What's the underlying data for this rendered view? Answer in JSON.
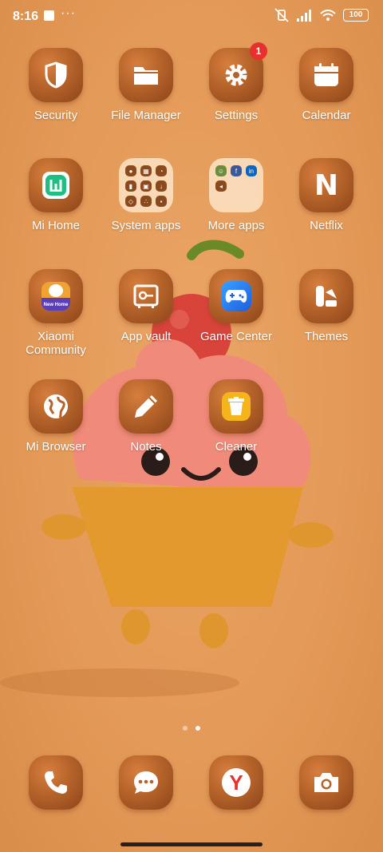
{
  "status_bar": {
    "time": "8:16",
    "battery": "100"
  },
  "apps": [
    {
      "label": "Security",
      "icon": "shield-icon"
    },
    {
      "label": "File Manager",
      "icon": "folder-icon"
    },
    {
      "label": "Settings",
      "icon": "gear-icon",
      "badge": "1"
    },
    {
      "label": "Calendar",
      "icon": "calendar-icon"
    },
    {
      "label": "Mi Home",
      "icon": "mi-home-icon"
    },
    {
      "label": "System apps",
      "icon": "folder-grid"
    },
    {
      "label": "More apps",
      "icon": "folder-grid"
    },
    {
      "label": "Netflix",
      "icon": "netflix-icon",
      "icon_text": "N"
    },
    {
      "label": "Xiaomi\nCommunity",
      "icon": "xiaomi-community-icon",
      "icon_text": "New Home"
    },
    {
      "label": "App vault",
      "icon": "vault-icon"
    },
    {
      "label": "Game Center",
      "icon": "gamepad-icon"
    },
    {
      "label": "Themes",
      "icon": "themes-icon"
    },
    {
      "label": "Mi Browser",
      "icon": "globe-icon"
    },
    {
      "label": "Notes",
      "icon": "pencil-icon"
    },
    {
      "label": "Cleaner",
      "icon": "trash-icon"
    }
  ],
  "dock": [
    {
      "name": "Phone",
      "icon": "phone-icon"
    },
    {
      "name": "Messaging",
      "icon": "message-icon"
    },
    {
      "name": "Yandex",
      "icon": "yandex-icon",
      "icon_text": "Y"
    },
    {
      "name": "Camera",
      "icon": "camera-icon"
    }
  ],
  "pages": {
    "count": 2,
    "current": 2
  },
  "colors": {
    "background": "#e49a58",
    "icon_bg": "#b5632a",
    "badge": "#e8302c"
  }
}
